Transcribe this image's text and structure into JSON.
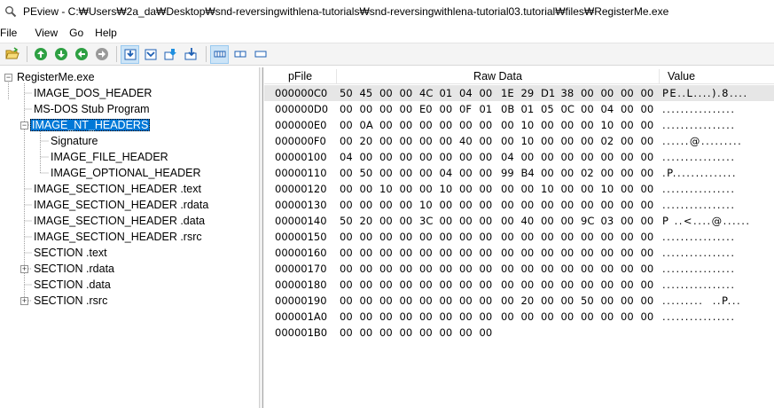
{
  "window": {
    "title": "PEview - C:₩Users₩2a_da₩Desktop₩snd-reversingwithlena-tutorials₩snd-reversingwithlena-tutorial03.tutorial₩files₩RegisterMe.exe",
    "icon": "magnifier-icon"
  },
  "menu": [
    "File",
    "View",
    "Go",
    "Help"
  ],
  "toolbar": {
    "icons": [
      "open-file-icon",
      "go-back-icon",
      "go-forward-icon",
      "go-previous-icon",
      "go-next-icon",
      "view-hex-byte-icon",
      "view-hex-word-icon",
      "view-hex-dword-icon",
      "view-hex-qword-icon",
      "view-raw-icon",
      "view-section-icon",
      "view-address-icon"
    ]
  },
  "tree": {
    "root": "RegisterMe.exe",
    "items": [
      {
        "label": "IMAGE_DOS_HEADER",
        "level": 1,
        "expander": ""
      },
      {
        "label": "MS-DOS Stub Program",
        "level": 1,
        "expander": ""
      },
      {
        "label": "IMAGE_NT_HEADERS",
        "level": 1,
        "expander": "-",
        "selected": true
      },
      {
        "label": "Signature",
        "level": 2,
        "expander": ""
      },
      {
        "label": "IMAGE_FILE_HEADER",
        "level": 2,
        "expander": ""
      },
      {
        "label": "IMAGE_OPTIONAL_HEADER",
        "level": 2,
        "expander": ""
      },
      {
        "label": "IMAGE_SECTION_HEADER .text",
        "level": 1,
        "expander": ""
      },
      {
        "label": "IMAGE_SECTION_HEADER .rdata",
        "level": 1,
        "expander": ""
      },
      {
        "label": "IMAGE_SECTION_HEADER .data",
        "level": 1,
        "expander": ""
      },
      {
        "label": "IMAGE_SECTION_HEADER .rsrc",
        "level": 1,
        "expander": ""
      },
      {
        "label": "SECTION .text",
        "level": 1,
        "expander": ""
      },
      {
        "label": "SECTION .rdata",
        "level": 1,
        "expander": "+"
      },
      {
        "label": "SECTION .data",
        "level": 1,
        "expander": ""
      },
      {
        "label": "SECTION .rsrc",
        "level": 1,
        "expander": "+"
      }
    ]
  },
  "hex": {
    "columns": [
      "pFile",
      "Raw Data",
      "Value"
    ],
    "rows": [
      {
        "addr": "000000C0",
        "bytes": "50 45 00 00 4C 01 04 00  1E 29 D1 38 00 00 00 00",
        "ascii": "PE..L....).8....",
        "selected": true
      },
      {
        "addr": "000000D0",
        "bytes": "00 00 00 00 E0 00 0F 01  0B 01 05 0C 00 04 00 00",
        "ascii": "................"
      },
      {
        "addr": "000000E0",
        "bytes": "00 0A 00 00 00 00 00 00  00 10 00 00 00 10 00 00",
        "ascii": "................"
      },
      {
        "addr": "000000F0",
        "bytes": "00 20 00 00 00 00 40 00  00 10 00 00 00 02 00 00",
        "ascii": "......@........."
      },
      {
        "addr": "00000100",
        "bytes": "04 00 00 00 00 00 00 00  04 00 00 00 00 00 00 00",
        "ascii": "................"
      },
      {
        "addr": "00000110",
        "bytes": "00 50 00 00 00 04 00 00  99 B4 00 00 02 00 00 00",
        "ascii": ".P.............."
      },
      {
        "addr": "00000120",
        "bytes": "00 00 10 00 00 10 00 00  00 00 10 00 00 10 00 00",
        "ascii": "................"
      },
      {
        "addr": "00000130",
        "bytes": "00 00 00 00 10 00 00 00  00 00 00 00 00 00 00 00",
        "ascii": "................"
      },
      {
        "addr": "00000140",
        "bytes": "50 20 00 00 3C 00 00 00  00 40 00 00 9C 03 00 00",
        "ascii": "P ..<....@......"
      },
      {
        "addr": "00000150",
        "bytes": "00 00 00 00 00 00 00 00  00 00 00 00 00 00 00 00",
        "ascii": "................"
      },
      {
        "addr": "00000160",
        "bytes": "00 00 00 00 00 00 00 00  00 00 00 00 00 00 00 00",
        "ascii": "................"
      },
      {
        "addr": "00000170",
        "bytes": "00 00 00 00 00 00 00 00  00 00 00 00 00 00 00 00",
        "ascii": "................"
      },
      {
        "addr": "00000180",
        "bytes": "00 00 00 00 00 00 00 00  00 00 00 00 00 00 00 00",
        "ascii": "................"
      },
      {
        "addr": "00000190",
        "bytes": "00 00 00 00 00 00 00 00  00 20 00 00 50 00 00 00",
        "ascii": ".........  ..P..."
      },
      {
        "addr": "000001A0",
        "bytes": "00 00 00 00 00 00 00 00  00 00 00 00 00 00 00 00",
        "ascii": "................"
      },
      {
        "addr": "000001B0",
        "bytes": "00 00 00 00 00 00 00 00",
        "ascii": ""
      }
    ]
  }
}
